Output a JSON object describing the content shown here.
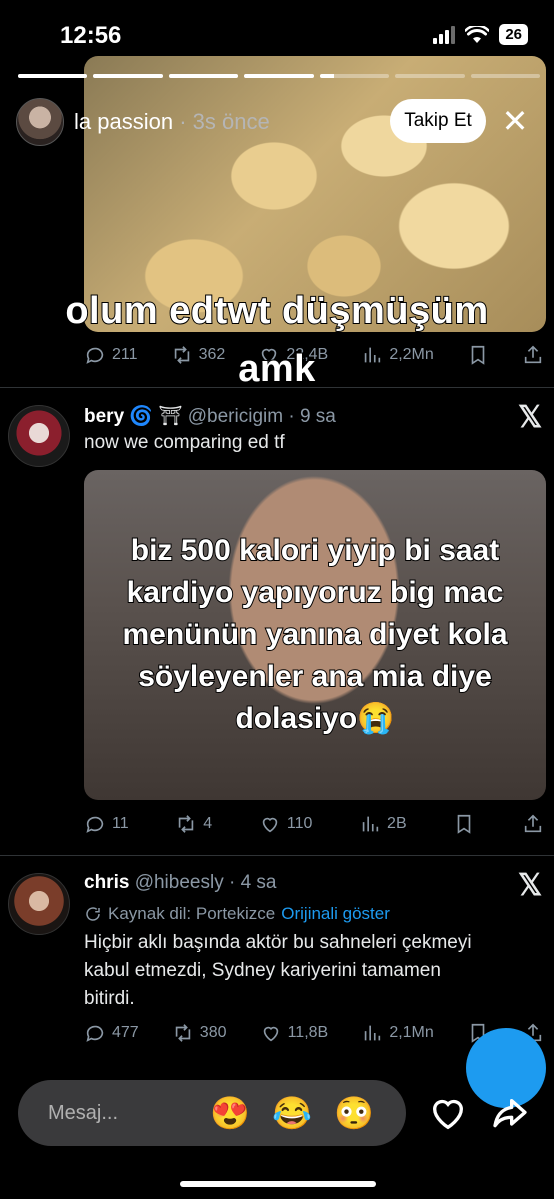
{
  "status": {
    "time": "12:56",
    "battery": "26"
  },
  "story": {
    "progress": [
      1,
      1,
      1,
      1,
      0.2,
      0,
      0
    ],
    "username": "la passion",
    "time_ago": " · 3s önce",
    "follow_label": "Takip Et",
    "caption_line1": "olum edtwt düşmüşüm",
    "caption_line2": "amk",
    "metrics": {
      "replies": "211",
      "retweets": "362",
      "likes": "22,4B",
      "views": "2,2Mn"
    }
  },
  "tweet1": {
    "name": "bery",
    "name_symbols": "🌀 ⛩",
    "handle": "@bericigim",
    "time": " · 9 sa",
    "text": "now we comparing ed tf",
    "media_caption_lines": [
      "biz 500 kalori yiyip bi saat",
      "kardiyo yapıyoruz big mac",
      "menünün yanına diyet kola",
      "söyleyenler ana mia diye",
      "dolasiyo😭"
    ],
    "metrics": {
      "replies": "11",
      "retweets": "4",
      "likes": "110",
      "views": "2B"
    }
  },
  "tweet2": {
    "name": "chris",
    "handle": "@hibeesly",
    "time": " · 4 sa",
    "source_label": "Kaynak dil: Portekizce",
    "show_original": "Orijinali göster",
    "text_line1": "Hiçbir aklı başında aktör bu sahneleri çekmeyi",
    "text_line2": "kabul etmezdi, Sydney kariyerini tamamen",
    "text_line3": "bitirdi.",
    "metrics": {
      "replies": "477",
      "retweets": "380",
      "likes": "11,8B",
      "views": "2,1Mn"
    }
  },
  "bottom": {
    "placeholder": "Mesaj...",
    "emojis": [
      "😍",
      "😂",
      "😳"
    ]
  },
  "colors": {
    "accent": "#1d9bf0",
    "muted": "#8b98a5"
  }
}
